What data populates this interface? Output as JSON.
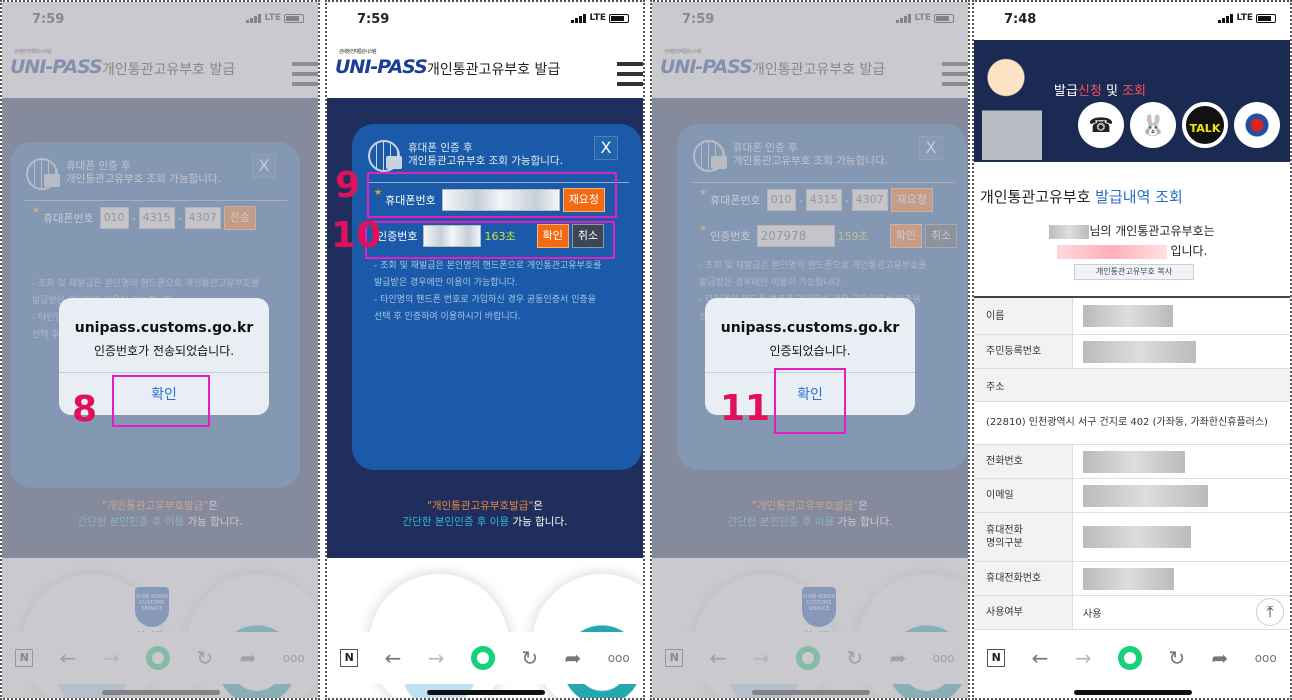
{
  "common": {
    "logo": "UNI-PASS",
    "logo_sub": "관세청 전자통관시스템",
    "header_title": "개인통관고유부호  발급",
    "card_title": [
      "휴대폰 인증 후",
      "개인통관고유부호 조회 가능합니다."
    ],
    "card_close": "X",
    "phone_label": "휴대폰번호",
    "auth_label": "인증번호",
    "notes": [
      "- 조회 및 재발급은 본인명의 핸드폰으로 개인통관고유부호를",
      "  발급받은 경우에만 이용이 가능합니다.",
      "- 타인명의 핸드폰 번호로 가입하신 경우 공동인증서 인증을",
      "  선택 후 인증하여 이용하시기 바랍니다."
    ],
    "footer": {
      "quote": "\"개인통관고유부호발급\"",
      "quote_suffix": "은",
      "highlight": "간단한 본인인증 후 이용",
      "suffix": " 가능 합니다."
    },
    "badge": "관세청 KOREA CUSTOMS SERVICE",
    "badge_label": "처리중",
    "network": "LTE",
    "toolbar": {
      "naver": "N",
      "back": "←",
      "forward": "→",
      "refresh": "↻",
      "share": "➦",
      "more": "ooo"
    },
    "alert_domain": "unipass.customs.go.kr",
    "alert_ok": "확인"
  },
  "panels": [
    {
      "time": "7:59",
      "phone": [
        "010",
        "4315",
        "4307"
      ],
      "send_label": "전송",
      "alert_message": "인증번호가 전송되었습니다.",
      "step": "8"
    },
    {
      "time": "7:59",
      "resend_label": "재요청",
      "timer": "163초",
      "confirm_label": "확인",
      "cancel_label": "취소",
      "steps": [
        "9",
        "10"
      ]
    },
    {
      "time": "7:59",
      "phone": [
        "010",
        "4315",
        "4307"
      ],
      "resend_label": "재요청",
      "auth_code": "207978",
      "timer": "159초",
      "confirm_label": "확인",
      "cancel_label": "취소",
      "alert_message": "인증되었습니다.",
      "step": "11"
    }
  ],
  "result": {
    "time": "7:48",
    "banner_title": [
      "발급",
      "신청",
      " 및 ",
      "조회"
    ],
    "talk": "TALK",
    "title": [
      "개인통관고유부호 ",
      "발급내역 조회"
    ],
    "owner_suffix": "님의 개인통관고유부호는",
    "code_suffix": " 입니다.",
    "copy_button": "개인통관고유부호 복사",
    "rows": [
      {
        "label": "이름"
      },
      {
        "label": "주민등록번호"
      },
      {
        "label": "주소",
        "full": true
      },
      {
        "value": "(22810)  인천광역시 서구 건지로 402 (가좌동, 가좌한신휴플러스)",
        "full": true
      },
      {
        "label": "전화번호"
      },
      {
        "label": "이메일"
      },
      {
        "label": "휴대전화\n명의구분"
      },
      {
        "label": "휴대전화번호"
      },
      {
        "label": "사용여부",
        "value": "사용"
      }
    ],
    "top_button": "⤒"
  },
  "colors": {
    "navy": "#1f2e5c",
    "card": "#1a5aa8",
    "orange": "#f26a12",
    "annotation": "#e020c0",
    "step_number": "#e0105a",
    "link_blue": "#2b6fd8"
  }
}
